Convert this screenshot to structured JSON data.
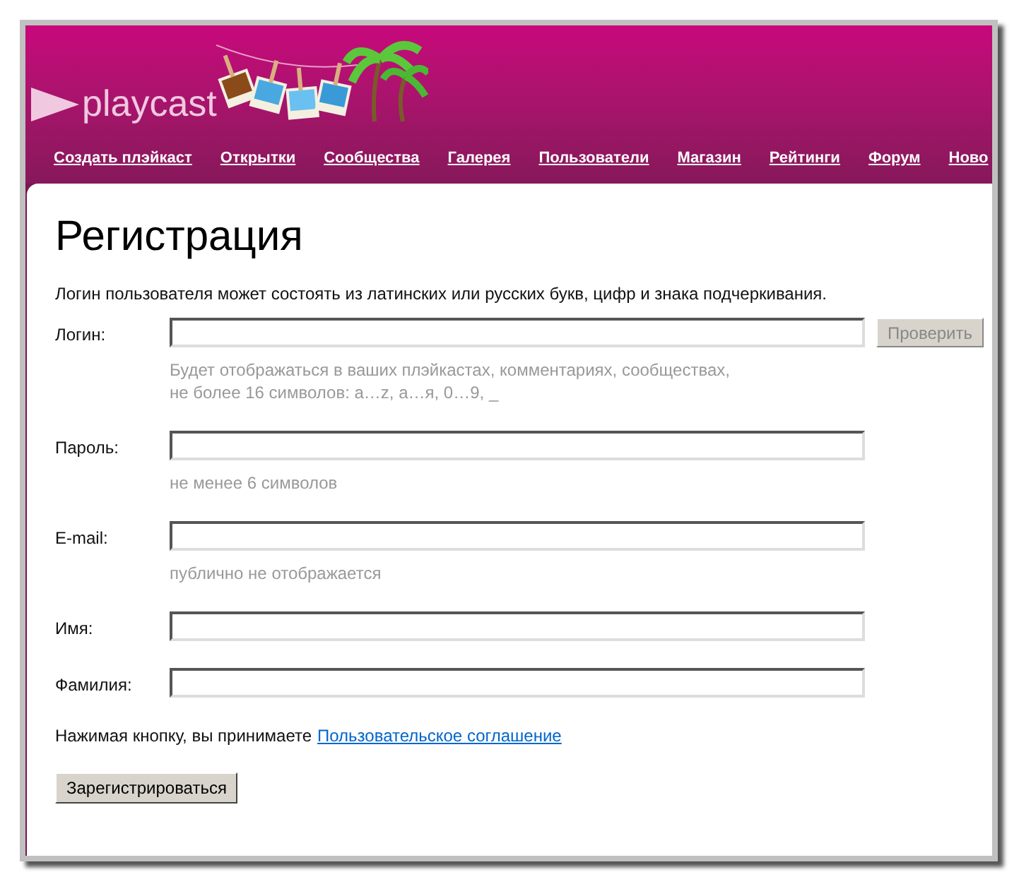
{
  "logo": {
    "text": "playcast"
  },
  "nav": [
    "Создать плэйкаст",
    "Открытки",
    "Сообщества",
    "Галерея",
    "Пользователи",
    "Магазин",
    "Рейтинги",
    "Форум",
    "Ново"
  ],
  "title": "Регистрация",
  "intro": "Логин пользователя может состоять из латинских или русских букв, цифр и знака подчеркивания.",
  "fields": [
    {
      "label": "Логин:",
      "button": "Проверить",
      "hint": [
        "Будет отображаться в ваших плэйкастах, комментариях, сообществах,",
        "не более 16 символов: a…z, а…я, 0…9, _"
      ]
    },
    {
      "label": "Пароль:",
      "hint": [
        "не менее 6 символов"
      ]
    },
    {
      "label": "E-mail:",
      "hint": [
        "публично не отображается"
      ]
    },
    {
      "label": "Имя:"
    },
    {
      "label": "Фамилия:"
    }
  ],
  "agreement": {
    "text": "Нажимая кнопку, вы принимаете",
    "link": "Пользовательское соглашение"
  },
  "submit": "Зарегистрироваться"
}
